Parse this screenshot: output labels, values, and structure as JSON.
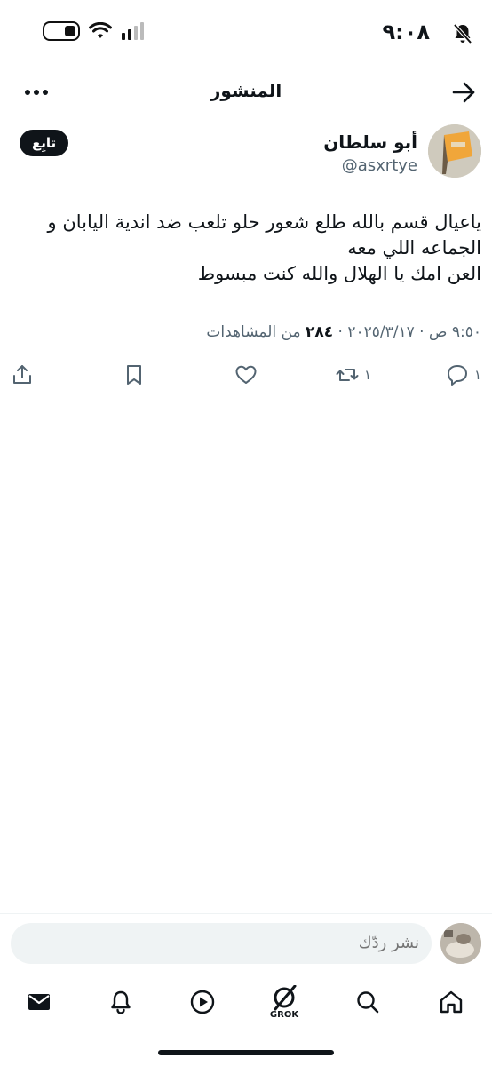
{
  "status_bar": {
    "time": "٩:٠٨",
    "icons": [
      "bell-off-icon",
      "battery-icon",
      "wifi-icon",
      "signal-icon"
    ]
  },
  "header": {
    "title": "المنشور",
    "icons": [
      "back-arrow-icon",
      "more-icon"
    ]
  },
  "author": {
    "name": "أبو سلطان",
    "handle": "@asxrtye",
    "follow_label": "تابِع"
  },
  "post": {
    "text": "ياعيال قسم بالله طلع شعور حلو تلعب ضد اندية اليابان و الجماعه اللي معه\nالعن امك يا الهلال والله كنت مبسوط",
    "timestamp": "٩:٥٠ ص · ٢٠٢٥/٣/١٧ ·",
    "views_count": "٢٨٤",
    "views_label": "من المشاهدات"
  },
  "actions": {
    "reply_count": "١",
    "retweet_count": "١",
    "icons": [
      "reply-icon",
      "retweet-icon",
      "like-icon",
      "bookmark-icon",
      "share-icon"
    ]
  },
  "reply": {
    "placeholder": "نشر ردّك"
  },
  "tabs": {
    "grok_label": "GROK",
    "icons": [
      "home-icon",
      "search-icon",
      "grok-icon",
      "play-icon",
      "notifications-icon",
      "messages-icon"
    ]
  },
  "colors": {
    "text": "#0f1419",
    "secondary": "#536471",
    "input_bg": "#eff3f4"
  }
}
